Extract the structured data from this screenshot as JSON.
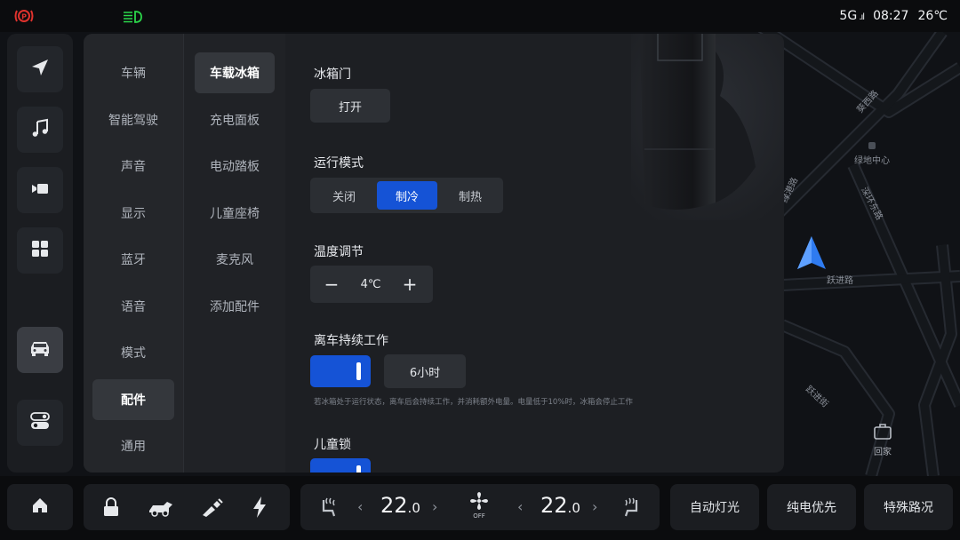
{
  "status_bar": {
    "network": "5G",
    "time": "08:27",
    "temperature": "26℃",
    "parking_brake_color": "#e0322d",
    "headlight_indicator_color": "#2bd84a"
  },
  "map": {
    "roads": [
      "葵西路",
      "绿港路",
      "深环东路",
      "跃进路",
      "跃进街"
    ],
    "poi_label": "绿地中心",
    "home_label": "回家"
  },
  "dock": {
    "items": [
      "navigation",
      "music",
      "video",
      "apps",
      "car",
      "controls"
    ],
    "active": "car"
  },
  "settings": {
    "categories": [
      "车辆",
      "智能驾驶",
      "声音",
      "显示",
      "蓝牙",
      "语音",
      "模式",
      "配件",
      "通用"
    ],
    "selected_category": "配件",
    "subcategories": [
      "车载冰箱",
      "充电面板",
      "电动踏板",
      "儿童座椅",
      "麦克风",
      "添加配件"
    ],
    "selected_subcategory": "车载冰箱",
    "fridge_door": {
      "title": "冰箱门",
      "button": "打开"
    },
    "run_mode": {
      "title": "运行模式",
      "options": [
        "关闭",
        "制冷",
        "制热"
      ],
      "selected": "制冷"
    },
    "temperature": {
      "title": "温度调节",
      "minus": "−",
      "value": "4℃",
      "plus": "+"
    },
    "keep_working": {
      "title": "离车持续工作",
      "enabled": true,
      "duration": "6小时",
      "note": "若冰箱处于运行状态，离车后会持续工作，并消耗额外电量。电量低于10%时，冰箱会停止工作"
    },
    "child_lock": {
      "title": "儿童锁",
      "enabled": true
    }
  },
  "bottom_bar": {
    "left_temp_int": "22",
    "left_temp_dec": ".0",
    "fan_label": "OFF",
    "right_temp_int": "22",
    "right_temp_dec": ".0",
    "quick_buttons": [
      "自动灯光",
      "纯电优先",
      "特殊路况"
    ]
  },
  "colors": {
    "accent": "#1553d6",
    "nav_arrow": "#2f7bf0"
  }
}
